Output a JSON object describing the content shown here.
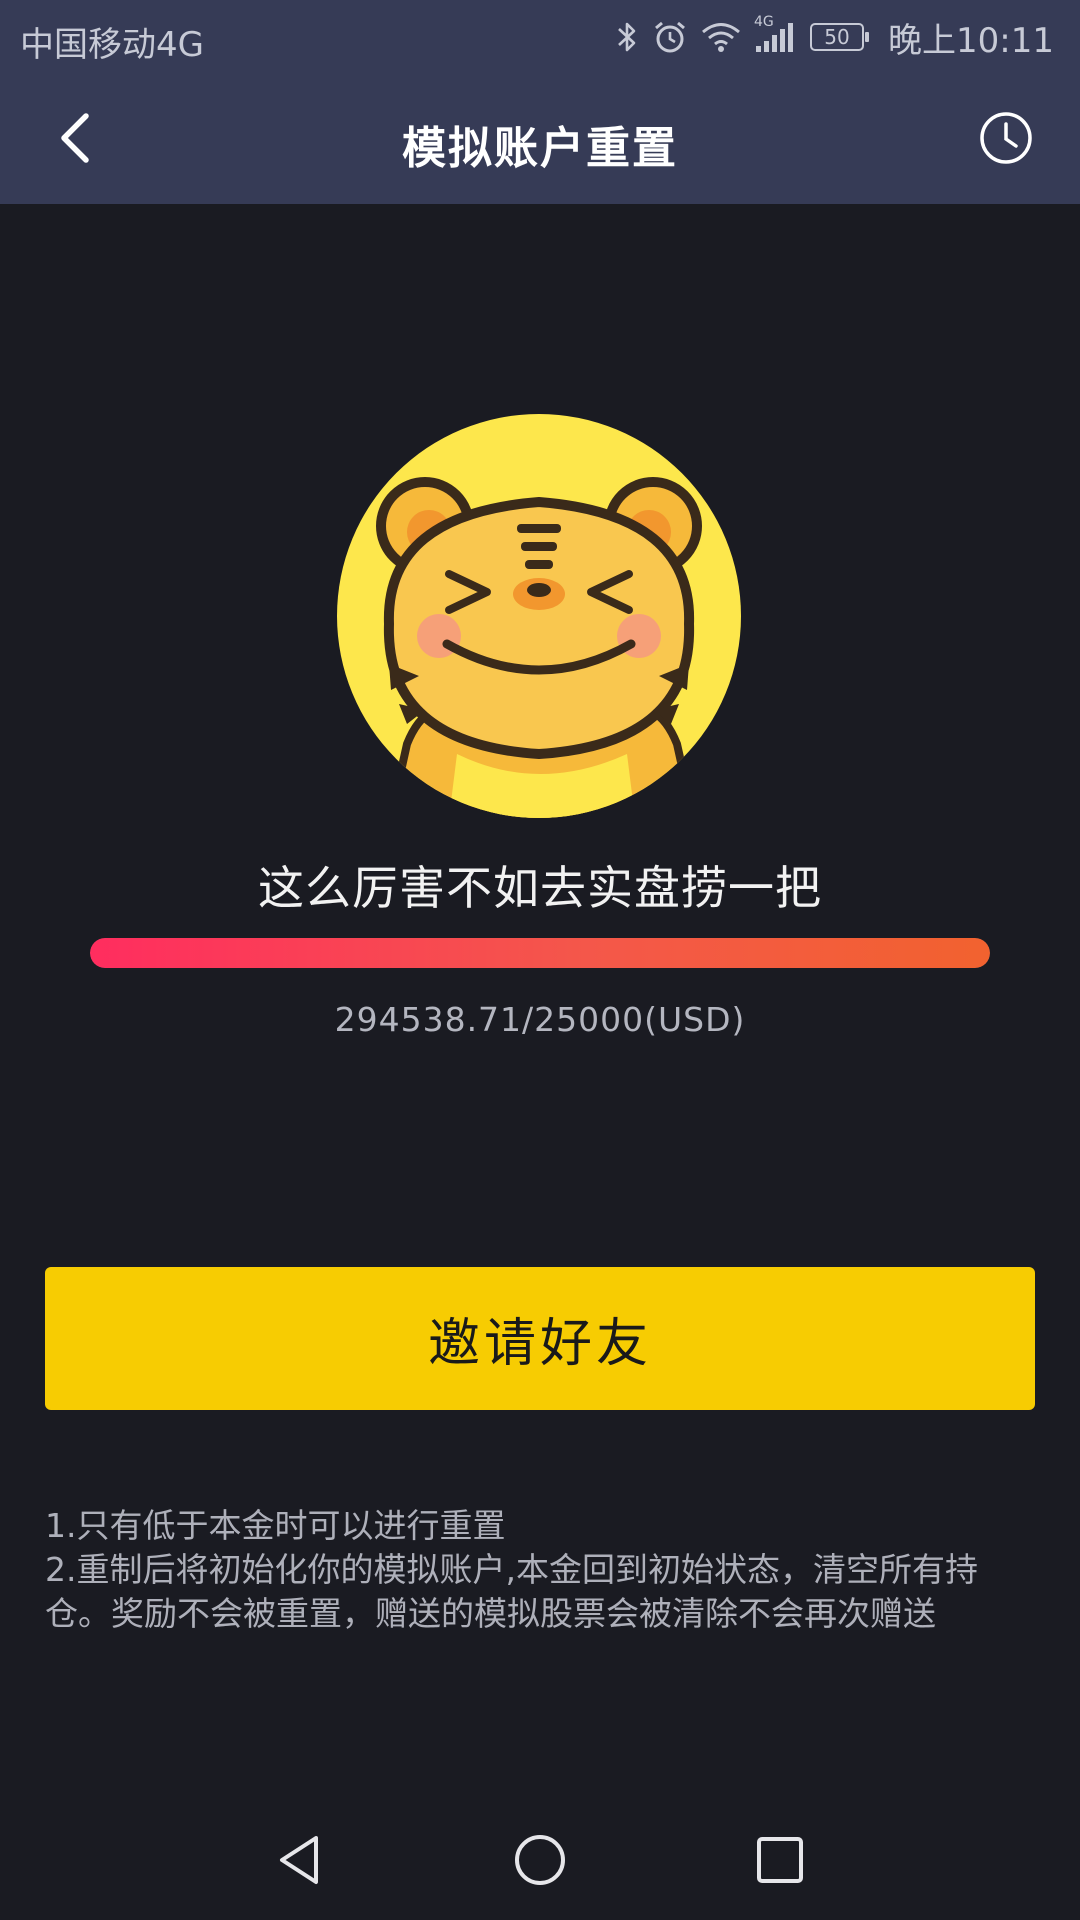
{
  "status_bar": {
    "carrier": "中国移动4G",
    "network_badge": "4G",
    "battery_level": "50",
    "time": "晚上10:11",
    "icons": [
      "bluetooth-icon",
      "alarm-icon",
      "wifi-icon",
      "signal-icon",
      "battery-icon"
    ]
  },
  "header": {
    "title": "模拟账户重置",
    "back_icon": "chevron-left-icon",
    "history_icon": "clock-icon"
  },
  "main": {
    "mascot": "tiger-mascot",
    "slogan": "这么厉害不如去实盘捞一把",
    "progress_fraction": 1.0,
    "balance_text": "294538.71/25000(USD)",
    "invite_button_label": "邀请好友"
  },
  "notes": {
    "line1": "1.只有低于本金时可以进行重置",
    "line2": "2.重制后将初始化你的模拟账户,本金回到初始状态，清空所有持仓。奖励不会被重置，赠送的模拟股票会被清除不会再次赠送"
  },
  "nav_bar": {
    "icons": [
      "back-triangle-icon",
      "home-circle-icon",
      "recents-square-icon"
    ]
  },
  "colors": {
    "header_bg": "#363b56",
    "page_bg": "#1a1b22",
    "accent_yellow": "#f7cc02",
    "progress_start": "#ff2d5f",
    "progress_end": "#f2622f"
  }
}
